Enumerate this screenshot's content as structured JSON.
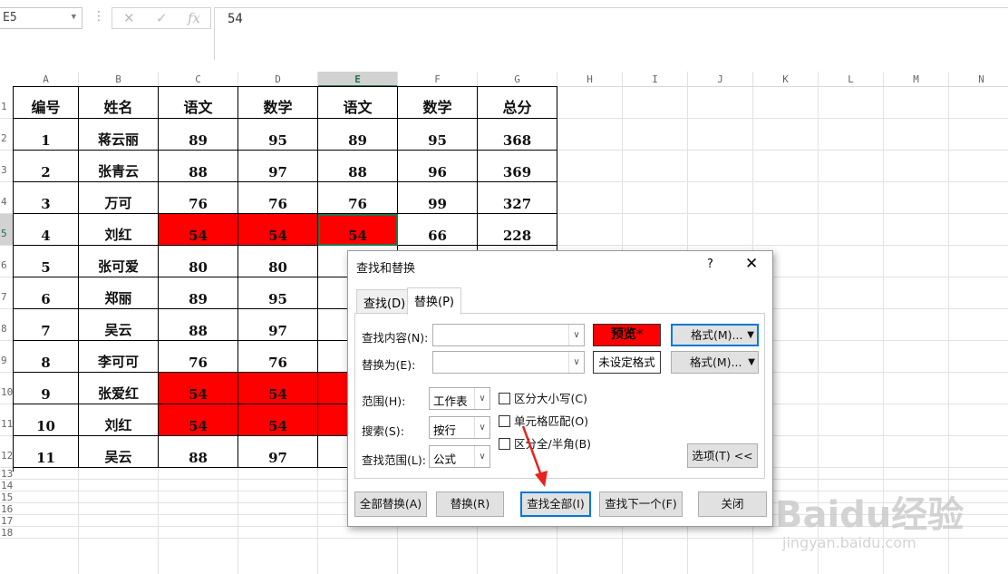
{
  "formula_bar": {
    "name_box": "E5",
    "cancel_icon": "✕",
    "enter_icon": "✓",
    "fx_icon": "fx",
    "formula": "54"
  },
  "columns": [
    "A",
    "B",
    "C",
    "D",
    "E",
    "F",
    "G",
    "H",
    "I",
    "J",
    "K",
    "L",
    "M",
    "N"
  ],
  "selected_column": "E",
  "rows": [
    "1",
    "2",
    "3",
    "4",
    "5",
    "6",
    "7",
    "8",
    "9",
    "10",
    "11",
    "12",
    "13",
    "14",
    "15",
    "16",
    "17",
    "18"
  ],
  "selected_row": "5",
  "table": {
    "headers": [
      "编号",
      "姓名",
      "语文",
      "数学",
      "语文",
      "数学",
      "总分"
    ],
    "rows": [
      [
        "1",
        "蒋云丽",
        "89",
        "95",
        "89",
        "95",
        "368"
      ],
      [
        "2",
        "张青云",
        "88",
        "97",
        "88",
        "96",
        "369"
      ],
      [
        "3",
        "万可",
        "76",
        "76",
        "76",
        "99",
        "327"
      ],
      [
        "4",
        "刘红",
        "54",
        "54",
        "54",
        "66",
        "228"
      ],
      [
        "5",
        "张可爱",
        "80",
        "80",
        "",
        "",
        ""
      ],
      [
        "6",
        "郑丽",
        "89",
        "95",
        "",
        "",
        ""
      ],
      [
        "7",
        "吴云",
        "88",
        "97",
        "",
        "",
        ""
      ],
      [
        "8",
        "李可可",
        "76",
        "76",
        "",
        "",
        ""
      ],
      [
        "9",
        "张爱红",
        "54",
        "54",
        "",
        "",
        ""
      ],
      [
        "10",
        "刘红",
        "54",
        "54",
        "",
        "",
        ""
      ],
      [
        "11",
        "吴云",
        "88",
        "97",
        "",
        "",
        ""
      ]
    ],
    "highlight_color": "#ff0000"
  },
  "dialog": {
    "title": "查找和替换",
    "help": "?",
    "close": "✕",
    "tabs": [
      "查找(D)",
      "替换(P)"
    ],
    "active_tab": "替换(P)",
    "find_label": "查找内容(N):",
    "find_value": "",
    "replace_label": "替换为(E):",
    "replace_value": "",
    "preview_label": "预览*",
    "no_format_label": "未设定格式",
    "format_button": "格式(M)...",
    "scope_label": "范围(H):",
    "scope_value": "工作表",
    "search_label": "搜索(S):",
    "search_value": "按行",
    "lookin_label": "查找范围(L):",
    "lookin_value": "公式",
    "match_case": "区分大小写(C)",
    "match_cell": "单元格匹配(O)",
    "match_width": "区分全/半角(B)",
    "options_button": "选项(T) <<",
    "buttons": {
      "replace_all": "全部替换(A)",
      "replace": "替换(R)",
      "find_all": "查找全部(I)",
      "find_next": "查找下一个(F)",
      "close": "关闭"
    }
  },
  "watermark": {
    "brand": "Baidu经验",
    "url": "jingyan.baidu.com"
  }
}
